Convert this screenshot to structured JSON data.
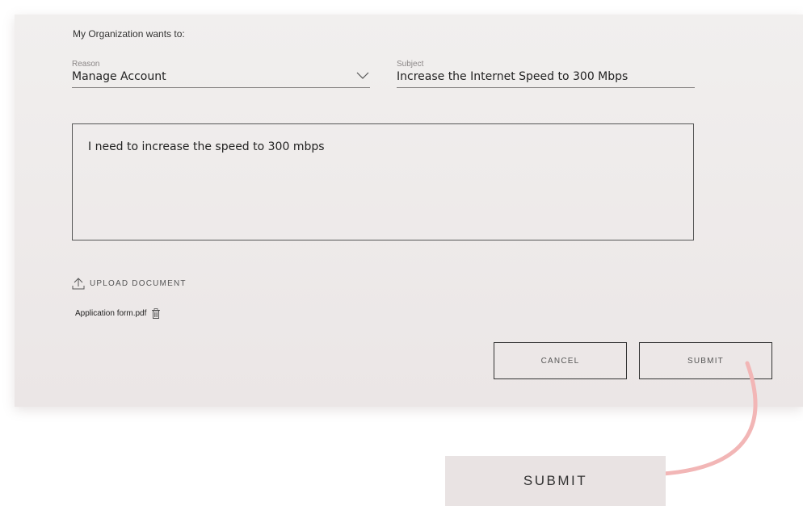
{
  "form": {
    "heading": "My Organization wants to:",
    "reason": {
      "label": "Reason",
      "value": "Manage Account"
    },
    "subject": {
      "label": "Subject",
      "value": "Increase the Internet Speed to 300 Mbps"
    },
    "message": "I need to increase the speed to 300 mbps",
    "upload_label": "UPLOAD DOCUMENT",
    "attachment_name": "Application form.pdf",
    "cancel_label": "CANCEL",
    "submit_label": "SUBMIT"
  },
  "callout": {
    "submit_label": "SUBMIT",
    "arrow_color": "#f2b6b6"
  },
  "icons": {
    "reason_dropdown": "chevron-down-icon",
    "upload": "upload-icon",
    "attachment_delete": "trash-icon",
    "callout_pointer": "arrow-icon"
  },
  "colors": {
    "card_background": "#ebe6e6",
    "callout_background": "#e9e3e3",
    "arrow": "#f2b6b6",
    "border": "#333333"
  }
}
